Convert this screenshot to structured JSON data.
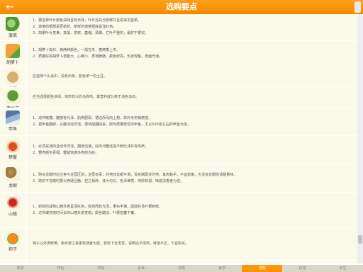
{
  "header": {
    "title": "选购要点",
    "back_icon": "←"
  },
  "items": [
    {
      "name": "菠菜",
      "icon": "cabbage-icon",
      "lines": [
        "1、要选择叶片颜色深绿且有光泽，叶片完充分新鲜并且看得见蓝菜。",
        "2、菠菜的根部是否新鲜、新鲜的菠菜根底是浅红色。",
        "3、如果叶片变黄、变黑、变软、萎缩、蔫瓣、烂叶严重的，最好不要买。"
      ]
    },
    {
      "name": "胡萝卜",
      "icon": "carrot-icon",
      "lines": [
        "1、胡萝卜有红、黄两种颜色，一般在冬、春两季上市。",
        "2、质量好的胡萝卜根粗大、心细小、质地脆嫩、颜色鲜亮，形状规整，表面光滑。"
      ]
    },
    {
      "name": "土豆",
      "icon": "potato-icon",
      "lines": [
        "应选择个头适中、没有出芽、颜色单一的土豆。"
      ]
    },
    {
      "name": "西兰花",
      "icon": "broccoli-icon",
      "lines": [
        "应当选择颜色浓绿、体形较大的乌骨鸡，其营养成分高于浅色乌鸡。"
      ]
    },
    {
      "name": "甲鱼",
      "icon": "fish-icon",
      "lines": [
        "1、动作敏捷、腹部有光泽、肌肉肥厚、裙边厚而向上翘，体外无伤病痕迹。",
        "2、把甲鱼翻转，头腹活动灵活，很快能翻回来，即为质量较优的甲鱼，尤以500克左右的甲鱼为佳。"
      ]
    },
    {
      "name": "螃蟹",
      "icon": "crab-icon",
      "lines": [
        "1、必须是活的且动作灵活，翻身迅速，好的河蟹还能不断吐沫并有响声。",
        "2、蟹壳颜色青绿、蟹腿饱满多肉的为好。"
      ]
    },
    {
      "name": "龙眼",
      "icon": "longan-icon",
      "lines": [
        "1、购买龙眼时应注意与龙荔区别，龙荔有毒，外壳较龙眼平滑，没有鳞斑状外壳，其肉粘手，不宜剥离，也没有龙眼的清甜香味。",
        "2、购买干龙眼时要以壳硬且脆、捏之易碎、体大均匀、色泽黄亮、肉厚软润、味甜清香者为佳。"
      ]
    },
    {
      "name": "山楂",
      "icon": "hawthorn-icon",
      "lines": [
        "1、新鲜的成熟山楂外表呈深红色，鲜亮而有光泽，果实丰满，圆鼓并且叶梗新鲜。",
        "2、过熟或存放时间长的山楂外皮变暗，颜色黯淡，叶梗枯萎干瘪。"
      ]
    },
    {
      "name": "柿子",
      "icon": "persimmon-icon",
      "lines": [
        "柿子以外表鲜黄、用手按之有柔软感者为佳，若软下去发觉，说明还不成熟，味道不正、下宜购买。"
      ]
    },
    {
      "name": "",
      "icon": "pomegranate-icon",
      "lines": []
    }
  ],
  "tabs": [
    {
      "label": "菜谱",
      "active": false
    },
    {
      "label": "特色",
      "active": false
    },
    {
      "label": "烘焙",
      "active": false
    },
    {
      "label": "素食",
      "active": false
    },
    {
      "label": "汤类",
      "active": false
    },
    {
      "label": "食疗",
      "active": false
    },
    {
      "label": "选购",
      "active": true
    },
    {
      "label": "存放",
      "active": false
    },
    {
      "label": "养生",
      "active": false
    }
  ],
  "colors": {
    "header": "#f39200",
    "active_tab": "#ff9500",
    "row_bg": "#fbf9e9"
  }
}
